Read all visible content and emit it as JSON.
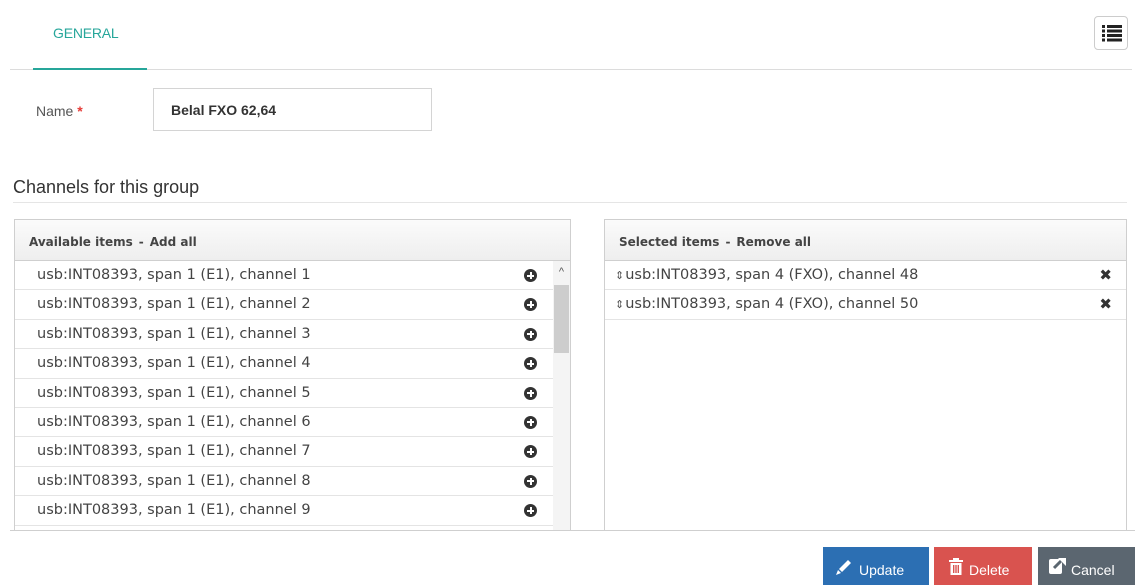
{
  "tabs": {
    "general_label": "GENERAL"
  },
  "form": {
    "name_label": "Name",
    "required_mark": "*",
    "name_value": "Belal FXO 62,64"
  },
  "channels": {
    "section_title": "Channels for this group",
    "available": {
      "header_label": "Available items",
      "separator": "-",
      "action_label": "Add all",
      "items": [
        "usb:INT08393, span 1 (E1), channel 1",
        "usb:INT08393, span 1 (E1), channel 2",
        "usb:INT08393, span 1 (E1), channel 3",
        "usb:INT08393, span 1 (E1), channel 4",
        "usb:INT08393, span 1 (E1), channel 5",
        "usb:INT08393, span 1 (E1), channel 6",
        "usb:INT08393, span 1 (E1), channel 7",
        "usb:INT08393, span 1 (E1), channel 8",
        "usb:INT08393, span 1 (E1), channel 9"
      ]
    },
    "selected": {
      "header_label": "Selected items",
      "separator": "-",
      "action_label": "Remove all",
      "grip_glyph": "⇕",
      "items": [
        "usb:INT08393, span 4 (FXO), channel 48",
        "usb:INT08393, span 4 (FXO), channel 50"
      ]
    }
  },
  "actions": {
    "update_label": "Update",
    "delete_label": "Delete",
    "cancel_label": "Cancel"
  },
  "icons": {
    "menu": "list-menu-icon",
    "add": "plus-circle-icon",
    "remove": "close-x-icon",
    "update": "pencil-icon",
    "delete": "trash-icon",
    "cancel": "share-out-icon"
  },
  "colors": {
    "accent_teal": "#26a69a",
    "update_bg": "#2c6fb3",
    "delete_bg": "#d9534f",
    "cancel_bg": "#5b6670",
    "required": "#e53935"
  }
}
